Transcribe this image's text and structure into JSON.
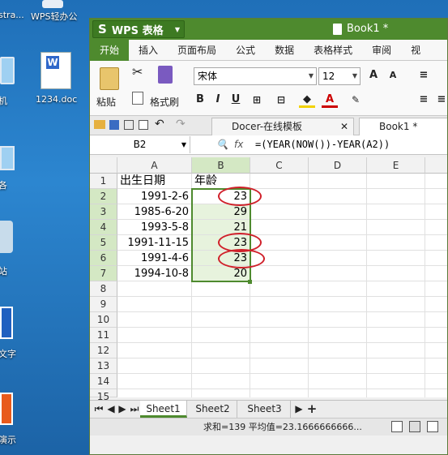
{
  "desktop": {
    "icons": [
      {
        "label": "stra..."
      },
      {
        "label": "WPS轻办公"
      },
      {
        "label": "机"
      },
      {
        "label": "1234.doc"
      },
      {
        "label": "各"
      },
      {
        "label": "站"
      },
      {
        "label": "文字"
      },
      {
        "label": "演示"
      }
    ]
  },
  "window": {
    "app_name": "WPS 表格",
    "doc_title": "Book1 *"
  },
  "menu": [
    "开始",
    "插入",
    "页面布局",
    "公式",
    "数据",
    "表格样式",
    "审阅",
    "视"
  ],
  "ribbon": {
    "paste_label": "粘贴",
    "format_painter_label": "格式刷",
    "font_name": "宋体",
    "font_size": "12",
    "bold": "B",
    "italic": "I",
    "underline": "U"
  },
  "doc_tabs": [
    {
      "label": "Docer-在线模板"
    },
    {
      "label": "Book1 *"
    }
  ],
  "formula_bar": {
    "cell_ref": "B2",
    "fx": "fx",
    "formula": "=(YEAR(NOW())-YEAR(A2))"
  },
  "grid": {
    "columns": [
      "A",
      "B",
      "C",
      "D",
      "E"
    ],
    "rows": [
      "1",
      "2",
      "3",
      "4",
      "5",
      "6",
      "7",
      "8",
      "9",
      "10",
      "11",
      "12",
      "13",
      "14",
      "15"
    ],
    "data": [
      [
        "出生日期",
        "年龄"
      ],
      [
        "1991-2-6",
        "23"
      ],
      [
        "1985-6-20",
        "29"
      ],
      [
        "1993-5-8",
        "21"
      ],
      [
        "1991-11-15",
        "23"
      ],
      [
        "1991-4-6",
        "23"
      ],
      [
        "1994-10-8",
        "20"
      ]
    ]
  },
  "sheets": [
    "Sheet1",
    "Sheet2",
    "Sheet3"
  ],
  "status": {
    "text": "求和=139  平均值=23.1666666666..."
  },
  "colors": {
    "accent": "#4e8a2e",
    "circle": "#d0202a"
  }
}
